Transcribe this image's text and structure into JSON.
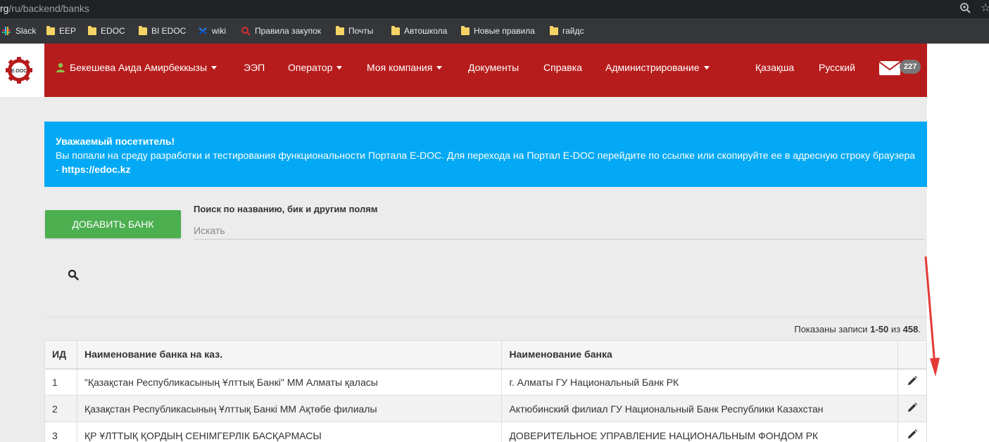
{
  "browser": {
    "url_prefix": "rg",
    "url_path": "/ru/backend/banks",
    "bookmarks": [
      {
        "label": "Slack",
        "icon": "slack-icon"
      },
      {
        "label": "EEP",
        "icon": "folder-icon"
      },
      {
        "label": "EDOC",
        "icon": "folder-icon"
      },
      {
        "label": "BI EDOC",
        "icon": "folder-icon"
      },
      {
        "label": "wiki",
        "icon": "confluence-icon"
      },
      {
        "label": "Правила закупок",
        "icon": "search-bookmark-icon"
      },
      {
        "label": "Почты",
        "icon": "folder-icon"
      },
      {
        "label": "Автошкола",
        "icon": "folder-icon"
      },
      {
        "label": "Новые правила",
        "icon": "folder-icon"
      },
      {
        "label": "гайдс",
        "icon": "folder-icon"
      }
    ]
  },
  "navbar": {
    "logo_text": "E-DOC",
    "user": "Бекешева Аида Амирбеккызы",
    "items": [
      "ЭЭП",
      "Оператор",
      "Моя компания",
      "Документы",
      "Справка",
      "Администрирование"
    ],
    "lang_kz": "Қазақша",
    "lang_ru": "Русский",
    "mail_count": "227"
  },
  "alert": {
    "title": "Уважаемый посетитель!",
    "text": "Вы попали на среду разработки и тестирования функциональности Портала E-DOC. Для перехода на Портал E-DOC перейдите по ссылке или скопируйте ее в адресную строку браузера - ",
    "link": "https://edoc.kz"
  },
  "controls": {
    "add_button": "Добавить банк",
    "search_label": "Поиск по названию, бик и другим полям",
    "search_placeholder": "Искать"
  },
  "summary": {
    "prefix": "Показаны записи ",
    "range": "1-50",
    "middle": " из ",
    "total": "458",
    "suffix": "."
  },
  "table": {
    "headers": [
      "ИД",
      "Наименование банка на каз.",
      "Наименование банка",
      ""
    ],
    "rows": [
      {
        "id": "1",
        "name_kz": "\"Қазақстан Республикасының Ұлттық Банкі\" ММ Алматы қаласы",
        "name_ru": "г. Алматы ГУ Национальный Банк РК"
      },
      {
        "id": "2",
        "name_kz": "Қазақстан Республикасының Ұлттық Банкі ММ Ақтөбе филиалы",
        "name_ru": "Актюбинский филиал ГУ Национальный Банк Республики Казахстан"
      },
      {
        "id": "3",
        "name_kz": "ҚР ҰЛТТЫҚ ҚОРДЫҢ СЕНІМГЕРЛІК БАСҚАРМАСЫ",
        "name_ru": "ДОВЕРИТЕЛЬНОЕ УПРАВЛЕНИЕ НАЦИОНАЛЬНЫМ ФОНДОМ РК"
      }
    ]
  },
  "colors": {
    "navbar": "#b71c1c",
    "alert": "#03a9f4",
    "add_button": "#4caf50",
    "annotation_arrow": "#e53935"
  }
}
